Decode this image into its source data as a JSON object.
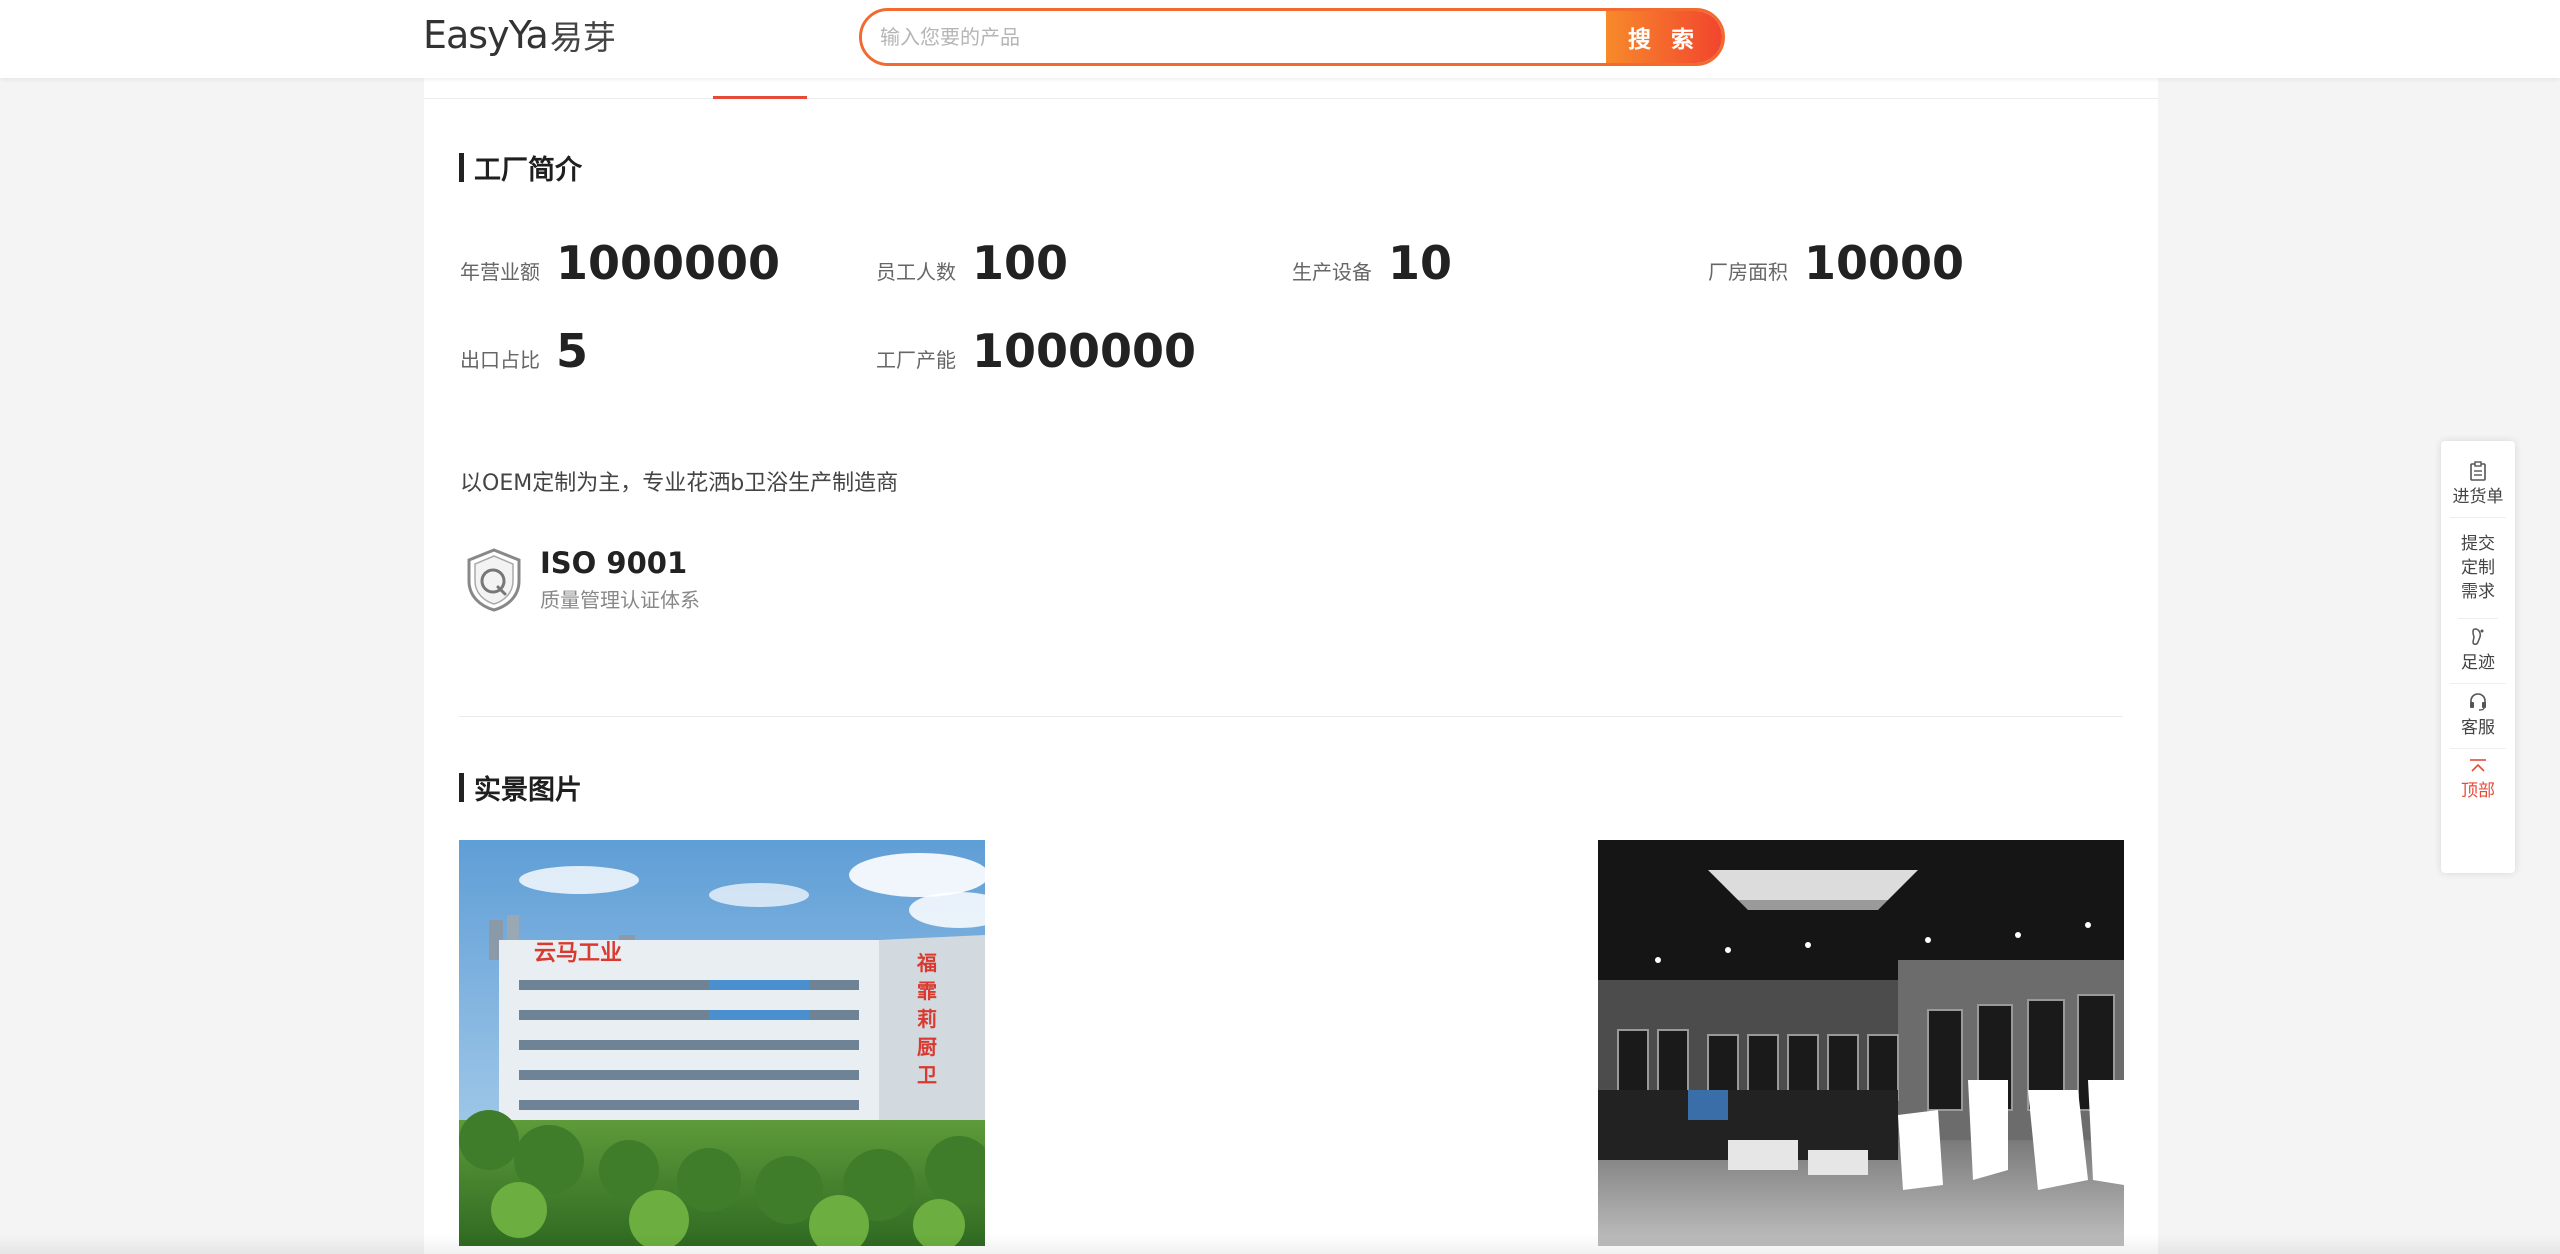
{
  "header": {
    "logo_latin": "EasyYa",
    "logo_cjk": "易芽",
    "search_placeholder": "输入您要的产品",
    "search_button": "搜 索"
  },
  "factory_intro": {
    "title": "工厂简介",
    "stats": [
      {
        "label": "年营业额",
        "value": "1000000"
      },
      {
        "label": "员工人数",
        "value": "100"
      },
      {
        "label": "生产设备",
        "value": "10"
      },
      {
        "label": "厂房面积",
        "value": "10000"
      },
      {
        "label": "出口占比",
        "value": "5"
      },
      {
        "label": "工厂产能",
        "value": "1000000"
      }
    ],
    "description": "以OEM定制为主，专业花洒b卫浴生产制造商",
    "certificate": {
      "name": "ISO 9001",
      "desc": "质量管理认证体系"
    }
  },
  "gallery": {
    "title": "实景图片",
    "factory_sign_text": "云马工业",
    "factory_side_text": "福霏莉厨卫"
  },
  "side_toolbar": {
    "items": [
      {
        "label": "进货单",
        "icon": "clipboard-icon"
      },
      {
        "label": "提交定制需求",
        "icon": ""
      },
      {
        "label": "足迹",
        "icon": "footprint-icon"
      },
      {
        "label": "客服",
        "icon": "headset-icon"
      },
      {
        "label": "顶部",
        "icon": "arrow-up-icon"
      }
    ]
  },
  "colors": {
    "accent": "#f2452f",
    "accent_orange": "#f78a2a",
    "background": "#f4f4f4"
  }
}
